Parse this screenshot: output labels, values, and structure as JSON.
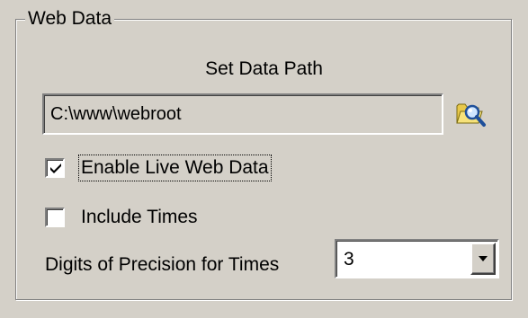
{
  "group": {
    "title": "Web Data"
  },
  "data_path": {
    "label": "Set Data Path",
    "value": "C:\\www\\webroot",
    "browse_icon": "folder-search-icon"
  },
  "options": {
    "live_web_data": {
      "label": "Enable Live Web Data",
      "checked": true
    },
    "include_times": {
      "label": "Include Times",
      "checked": false
    }
  },
  "precision": {
    "label": "Digits of Precision for Times",
    "selected": "3"
  },
  "colors": {
    "background": "#d4d0c8",
    "shadow": "#808080",
    "highlight": "#ffffff"
  }
}
